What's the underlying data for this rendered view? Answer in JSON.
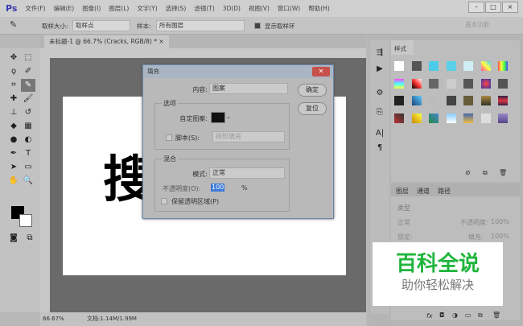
{
  "app": {
    "logo": "Ps",
    "menus": [
      "文件(F)",
      "编辑(E)",
      "图像(I)",
      "图层(L)",
      "文字(Y)",
      "选择(S)",
      "滤镜(T)",
      "3D(D)",
      "视图(V)",
      "窗口(W)",
      "帮助(H)"
    ],
    "window_buttons": [
      "–",
      "□",
      "×"
    ]
  },
  "options": {
    "sample_size_label": "取样大小:",
    "sample_size": "取样点",
    "sample_label": "样本:",
    "sample": "所有图层",
    "show_ring": "显示取样环",
    "workspace": "基本功能"
  },
  "document": {
    "tab": "未标题-1 @ 66.7% (Cracks, RGB/8) *",
    "tab_close": "×",
    "glyph": "搜",
    "zoom": "66.67%",
    "doc_info": "文档:1.14M/1.99M"
  },
  "styles_panel": {
    "title": "样式"
  },
  "layers_panel": {
    "tabs": [
      "图层",
      "通道",
      "路径"
    ],
    "filter": "类型",
    "blend": "正常",
    "opacity_label": "不透明度:",
    "opacity": "100%",
    "lock_label": "锁定:",
    "fill_label": "填充:",
    "fill": "100%"
  },
  "dialog": {
    "title": "填充",
    "content_label": "内容:",
    "content": "图案",
    "ok": "确定",
    "reset": "复位",
    "options_group": "选项",
    "custom_pattern_label": "自定图案:",
    "script_label": "脚本(S):",
    "script_value": "砖形填充",
    "blend_group": "混合",
    "mode_label": "模式:",
    "mode": "正常",
    "opacity_label": "不透明度(O):",
    "opacity": "100",
    "percent": "%",
    "preserve": "保留透明区域(P)"
  },
  "watermark": {
    "title": "百科全说",
    "subtitle": "助你轻松解决",
    "title_color": "#1fb53c"
  }
}
